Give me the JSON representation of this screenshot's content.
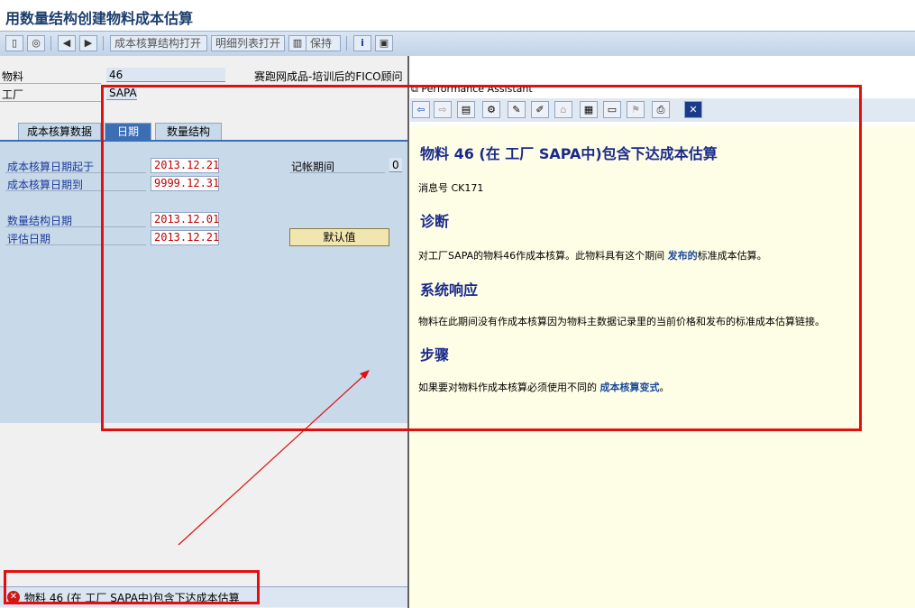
{
  "window": {
    "title": "用数量结构创建物料成本估算"
  },
  "toolbar": {
    "btn_open_costing_structure": "成本核算结构打开",
    "btn_open_detail_list": "明细列表打开",
    "btn_keep": "保持",
    "icons": [
      "new-document-icon",
      "glasses-icon",
      "back-arrow-icon",
      "forward-arrow-icon",
      "info-icon",
      "image-icon"
    ]
  },
  "header": {
    "material_label": "物料",
    "material_value": "46",
    "material_desc": "赛跑网成品-培训后的FICO顾问",
    "plant_label": "工厂",
    "plant_value": "SAPA"
  },
  "tabs": [
    "成本核算数据",
    "日期",
    "数量结构"
  ],
  "active_tab": "日期",
  "dates": {
    "costing_date_from_label": "成本核算日期起于",
    "costing_date_from": "2013.12.21",
    "costing_date_to_label": "成本核算日期到",
    "costing_date_to": "9999.12.31",
    "qty_structure_date_label": "数量结构日期",
    "qty_structure_date": "2013.12.01",
    "valuation_date_label": "评估日期",
    "valuation_date": "2013.12.21",
    "posting_period_label": "记帐期间",
    "posting_period_value": "0",
    "default_button": "默认值"
  },
  "status": {
    "type": "error",
    "text": "物料 46 (在 工厂 SAPA中)包含下达成本估算"
  },
  "performance_assistant": {
    "title": "Performance Assistant",
    "dots": ".....",
    "heading": "物料  46 (在  工厂  SAPA中)包含下达成本估算",
    "message_no": "消息号  CK171",
    "diagnosis_heading": "诊断",
    "diagnosis_text_before": "对工厂SAPA的物料46作成本核算。此物料具有这个期间 ",
    "diagnosis_link": "发布的",
    "diagnosis_text_after": "标准成本估算。",
    "system_response_heading": "系统响应",
    "system_response_text": "物料在此期间没有作成本核算因为物料主数据记录里的当前价格和发布的标准成本估算链接。",
    "procedure_heading": "步骤",
    "procedure_text_before": "如果要对物料作成本核算必须使用不同的 ",
    "procedure_link": "成本核算变式",
    "procedure_text_after": "。"
  },
  "colors": {
    "accent_blue": "#3c6eb4",
    "date_red": "#c00000",
    "annotation_red": "#e01010",
    "pa_background": "#fefee6"
  }
}
